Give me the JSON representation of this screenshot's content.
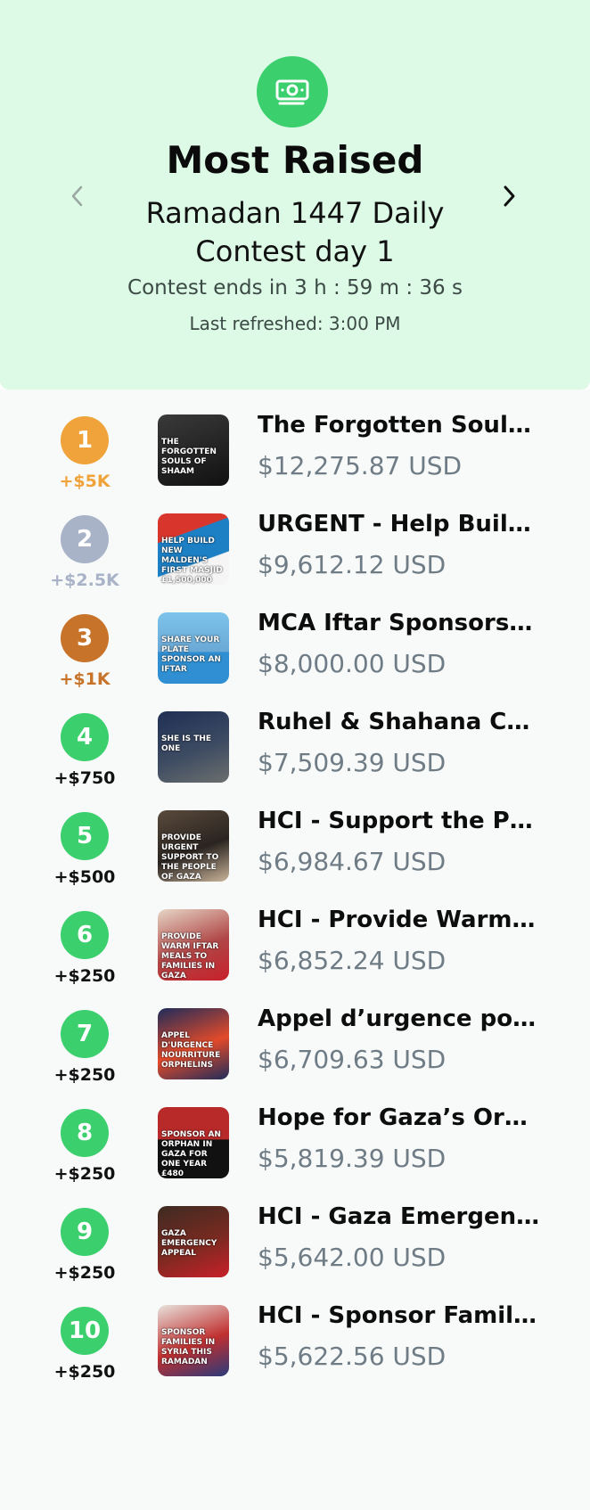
{
  "header": {
    "icon": "money-icon",
    "title": "Most Raised",
    "subtitle": "Ramadan 1447 Daily Contest day 1",
    "contest_ends": "Contest ends in 3 h : 59 m : 36 s",
    "last_refreshed": "Last refreshed: 3:00 PM",
    "prev_icon": "chevron-left-icon",
    "next_icon": "chevron-right-icon"
  },
  "colors": {
    "header_bg": "#dcfae6",
    "green": "#3ccf6e",
    "gold": "#f0a33a",
    "silver": "#a9b3c8",
    "bronze": "#c8732a"
  },
  "leaderboard": [
    {
      "rank": "1",
      "prize": "+$5K",
      "name": "The Forgotten Souls Of Shaam",
      "amount": "$12,275.87 USD",
      "thumb_text": "The Forgotten Souls of Shaam"
    },
    {
      "rank": "2",
      "prize": "+$2.5K",
      "name": "URGENT - Help Build New Malden's First Masjid",
      "amount": "$9,612.12 USD",
      "thumb_text": "Help build New Malden's first masjid £1,500,000"
    },
    {
      "rank": "3",
      "prize": "+$1K",
      "name": "MCA Iftar Sponsorship",
      "amount": "$8,000.00 USD",
      "thumb_text": "Share your plate Sponsor an iftar"
    },
    {
      "rank": "4",
      "prize": "+$750",
      "name": "Ruhel & Shahana Charity Project",
      "amount": "$7,509.39 USD",
      "thumb_text": "She is the one"
    },
    {
      "rank": "5",
      "prize": "+$500",
      "name": "HCI - Support the People of Gaza",
      "amount": "$6,984.67 USD",
      "thumb_text": "Provide urgent support to the people of Gaza"
    },
    {
      "rank": "6",
      "prize": "+$250",
      "name": "HCI - Provide Warm Iftar Meals",
      "amount": "$6,852.24 USD",
      "thumb_text": "Provide warm iftar meals to families in Gaza"
    },
    {
      "rank": "7",
      "prize": "+$250",
      "name": "Appel d’urgence pour les orphelins",
      "amount": "$6,709.63 USD",
      "thumb_text": "Appel d'urgence nourriture orphelins"
    },
    {
      "rank": "8",
      "prize": "+$250",
      "name": "Hope for Gaza’s Orphans",
      "amount": "$5,819.39 USD",
      "thumb_text": "Sponsor an orphan in Gaza for one year £480"
    },
    {
      "rank": "9",
      "prize": "+$250",
      "name": "HCI - Gaza Emergency Appeal",
      "amount": "$5,642.00 USD",
      "thumb_text": "Gaza emergency appeal"
    },
    {
      "rank": "10",
      "prize": "+$250",
      "name": "HCI - Sponsor Families in Syria",
      "amount": "$5,622.56 USD",
      "thumb_text": "Sponsor families in Syria this Ramadan"
    }
  ]
}
